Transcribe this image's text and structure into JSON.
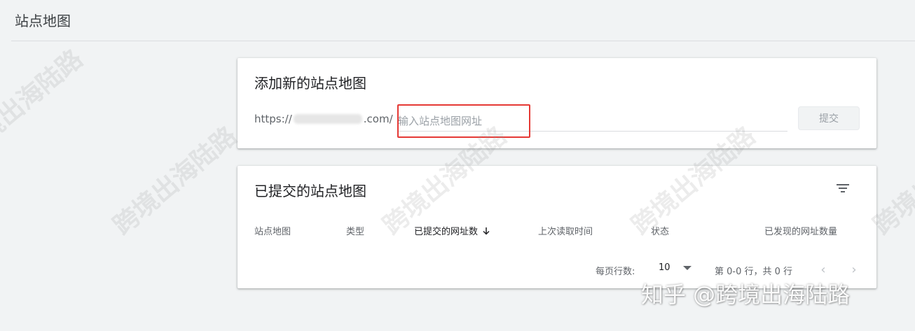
{
  "page": {
    "title": "站点地图"
  },
  "add_card": {
    "title": "添加新的站点地图",
    "url_prefix_start": "https://",
    "url_prefix_end": ".com/",
    "input_placeholder": "输入站点地图网址",
    "input_value": "",
    "submit_label": "提交"
  },
  "list_card": {
    "title": "已提交的站点地图",
    "columns": [
      "站点地图",
      "类型",
      "已提交的网址数",
      "上次读取时间",
      "状态",
      "已发现的网址数量"
    ],
    "sorted_column_index": 2,
    "pagination": {
      "rows_per_page_label": "每页行数:",
      "rows_per_page_value": "10",
      "range_text": "第 0-0 行，共 0 行"
    }
  },
  "overlay": {
    "watermark_text": "跨境出海陆路",
    "credit_text": "知乎 @跨境出海陆路"
  },
  "colors": {
    "background": "#f1f3f4",
    "card": "#ffffff",
    "highlight_border": "#e53935",
    "text_primary": "#202124",
    "text_secondary": "#5f6368"
  }
}
